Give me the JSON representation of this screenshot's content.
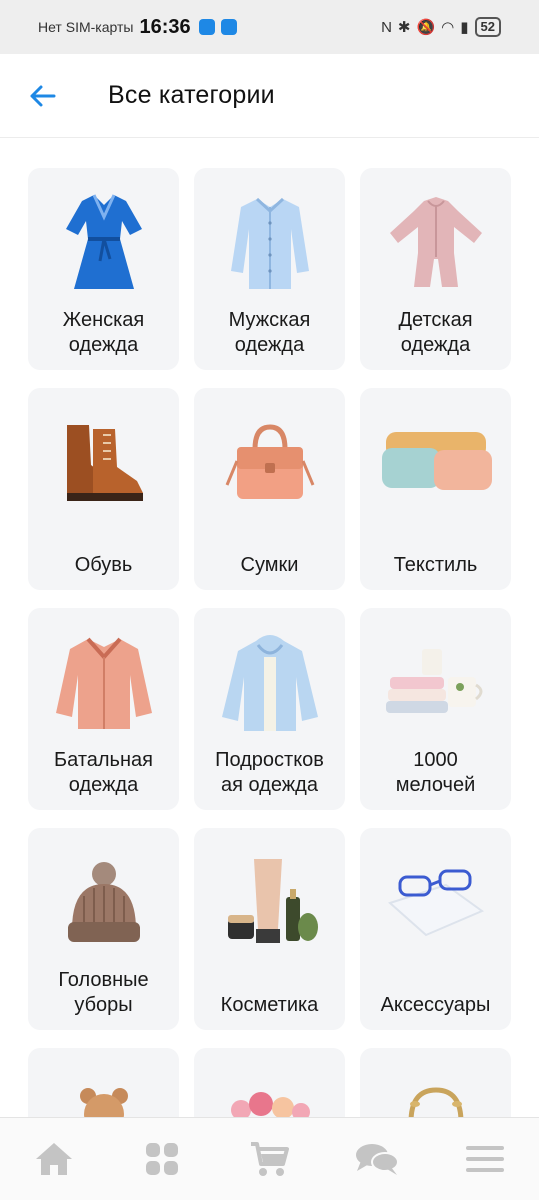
{
  "status_bar": {
    "carrier": "Нет SIM-карты",
    "time": "16:36",
    "battery": "52",
    "icons": [
      "nfc-icon",
      "bluetooth-icon",
      "mute-icon",
      "wifi-icon",
      "battery-saver-icon"
    ]
  },
  "header": {
    "back_icon": "arrow-left-icon",
    "title": "Все категории"
  },
  "categories": [
    {
      "label": "Женская\nодежда",
      "image": "blue-dress"
    },
    {
      "label": "Мужская\nодежда",
      "image": "light-blue-shirt"
    },
    {
      "label": "Детская\nодежда",
      "image": "pink-baby-jumpsuit"
    },
    {
      "label": "Обувь",
      "image": "brown-boots"
    },
    {
      "label": "Сумки",
      "image": "peach-handbag"
    },
    {
      "label": "Текстиль",
      "image": "pillows"
    },
    {
      "label": "Батальная\nодежда",
      "image": "pink-jacket"
    },
    {
      "label": "Подростков\nая одежда",
      "image": "blue-hoodie"
    },
    {
      "label": "1000\nмелочей",
      "image": "towels-and-cups"
    },
    {
      "label": "Головные\nуборы",
      "image": "knit-hat"
    },
    {
      "label": "Косметика",
      "image": "cosmetics-tubes"
    },
    {
      "label": "Аксессуары",
      "image": "glasses-on-cloth"
    },
    {
      "label": "",
      "image": "teddy-bear"
    },
    {
      "label": "",
      "image": "flowers"
    },
    {
      "label": "",
      "image": "gold-wreath"
    }
  ],
  "bottom_nav": [
    {
      "name": "home",
      "icon": "home-icon"
    },
    {
      "name": "catalog",
      "icon": "grid-icon"
    },
    {
      "name": "cart",
      "icon": "cart-icon"
    },
    {
      "name": "chat",
      "icon": "chat-icon"
    },
    {
      "name": "menu",
      "icon": "menu-icon"
    }
  ],
  "colors": {
    "accent": "#1e88e5",
    "card_bg": "#f4f5f7",
    "nav_icon": "#c4c4c4"
  }
}
